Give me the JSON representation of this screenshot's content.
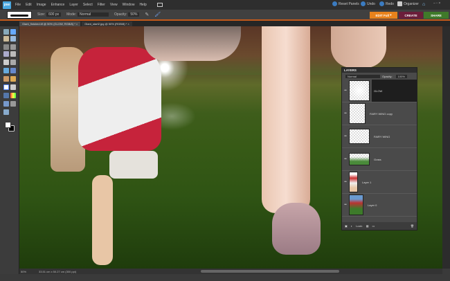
{
  "app": {
    "logo": "pse"
  },
  "menu": [
    "File",
    "Edit",
    "Image",
    "Enhance",
    "Layer",
    "Select",
    "Filter",
    "View",
    "Window",
    "Help"
  ],
  "top_right": {
    "reset_panels": "Reset Panels",
    "undo": "Undo",
    "redo": "Redo",
    "organizer": "Organizer"
  },
  "options": {
    "size_label": "Size:",
    "size_value": "600 px",
    "mode_label": "Mode:",
    "mode_value": "Normal",
    "opacity_label": "Opacity:",
    "opacity_value": "50%"
  },
  "modes": {
    "edit": "EDIT Full",
    "create": "CREATE",
    "share": "SHARE",
    "edit_color": "#e8821c",
    "create_color": "#6b1e3a",
    "share_color": "#3f7a2a"
  },
  "tabs": [
    {
      "label": "Giant_finished.tif @ 50% (GLOW, RGB/8) *"
    },
    {
      "label": "Giant_start2.jpg @ 50% (RGB/8) *"
    }
  ],
  "status": {
    "zoom": "50%",
    "doc_size": "33.51 cm x 50.27 cm (300 ppi)"
  },
  "layers_panel": {
    "title": "LAYERS",
    "blend_mode": "Normal",
    "opacity_label": "Opacity:",
    "opacity_value": "100%",
    "lock_label": "Lock:",
    "layers": [
      {
        "name": "GLOW",
        "selected": true
      },
      {
        "name": "FAIRY WING copy"
      },
      {
        "name": "FAIRY WING"
      },
      {
        "name": "Grass"
      },
      {
        "name": "Layer 1"
      },
      {
        "name": "Layer 0"
      }
    ]
  }
}
